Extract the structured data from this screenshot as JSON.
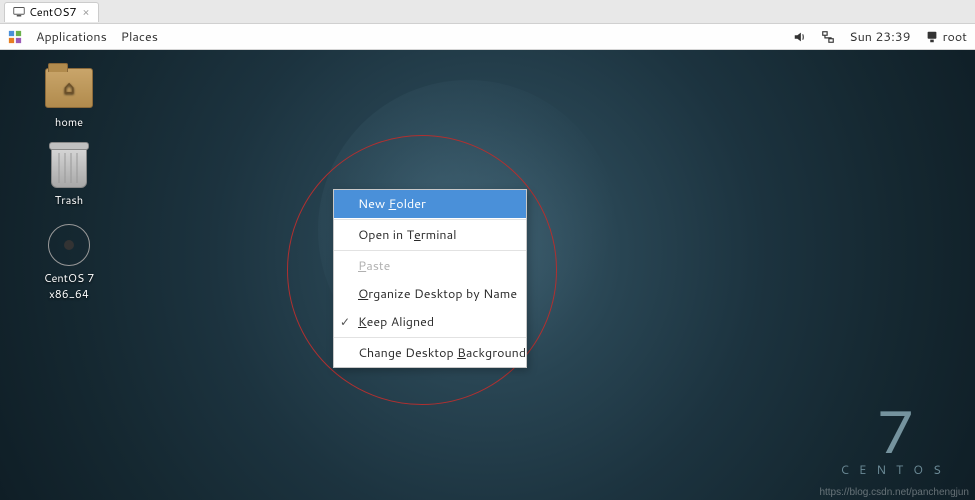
{
  "vm_tab": {
    "label": "CentOS7",
    "close": "×"
  },
  "top_bar": {
    "applications": "Applications",
    "places": "Places",
    "day_time": "Sun 23:39",
    "user": "root"
  },
  "desktop_icons": {
    "home": "home",
    "trash": "Trash",
    "disc": "CentOS 7 x86_64"
  },
  "context_menu": {
    "new_folder_pre": "New ",
    "new_folder_u": "F",
    "new_folder_post": "older",
    "open_term_pre": "Open in T",
    "open_term_u": "e",
    "open_term_post": "rminal",
    "paste_u": "P",
    "paste_post": "aste",
    "organize_pre": "",
    "organize_u": "O",
    "organize_post": "rganize Desktop by Name",
    "keep_pre": "",
    "keep_u": "K",
    "keep_post": "eep Aligned",
    "change_bg_pre": "Change Desktop ",
    "change_bg_u": "B",
    "change_bg_post": "ackground"
  },
  "brand": {
    "seven": "7",
    "name": "CENTOS"
  },
  "watermark": "https://blog.csdn.net/panchengjun"
}
